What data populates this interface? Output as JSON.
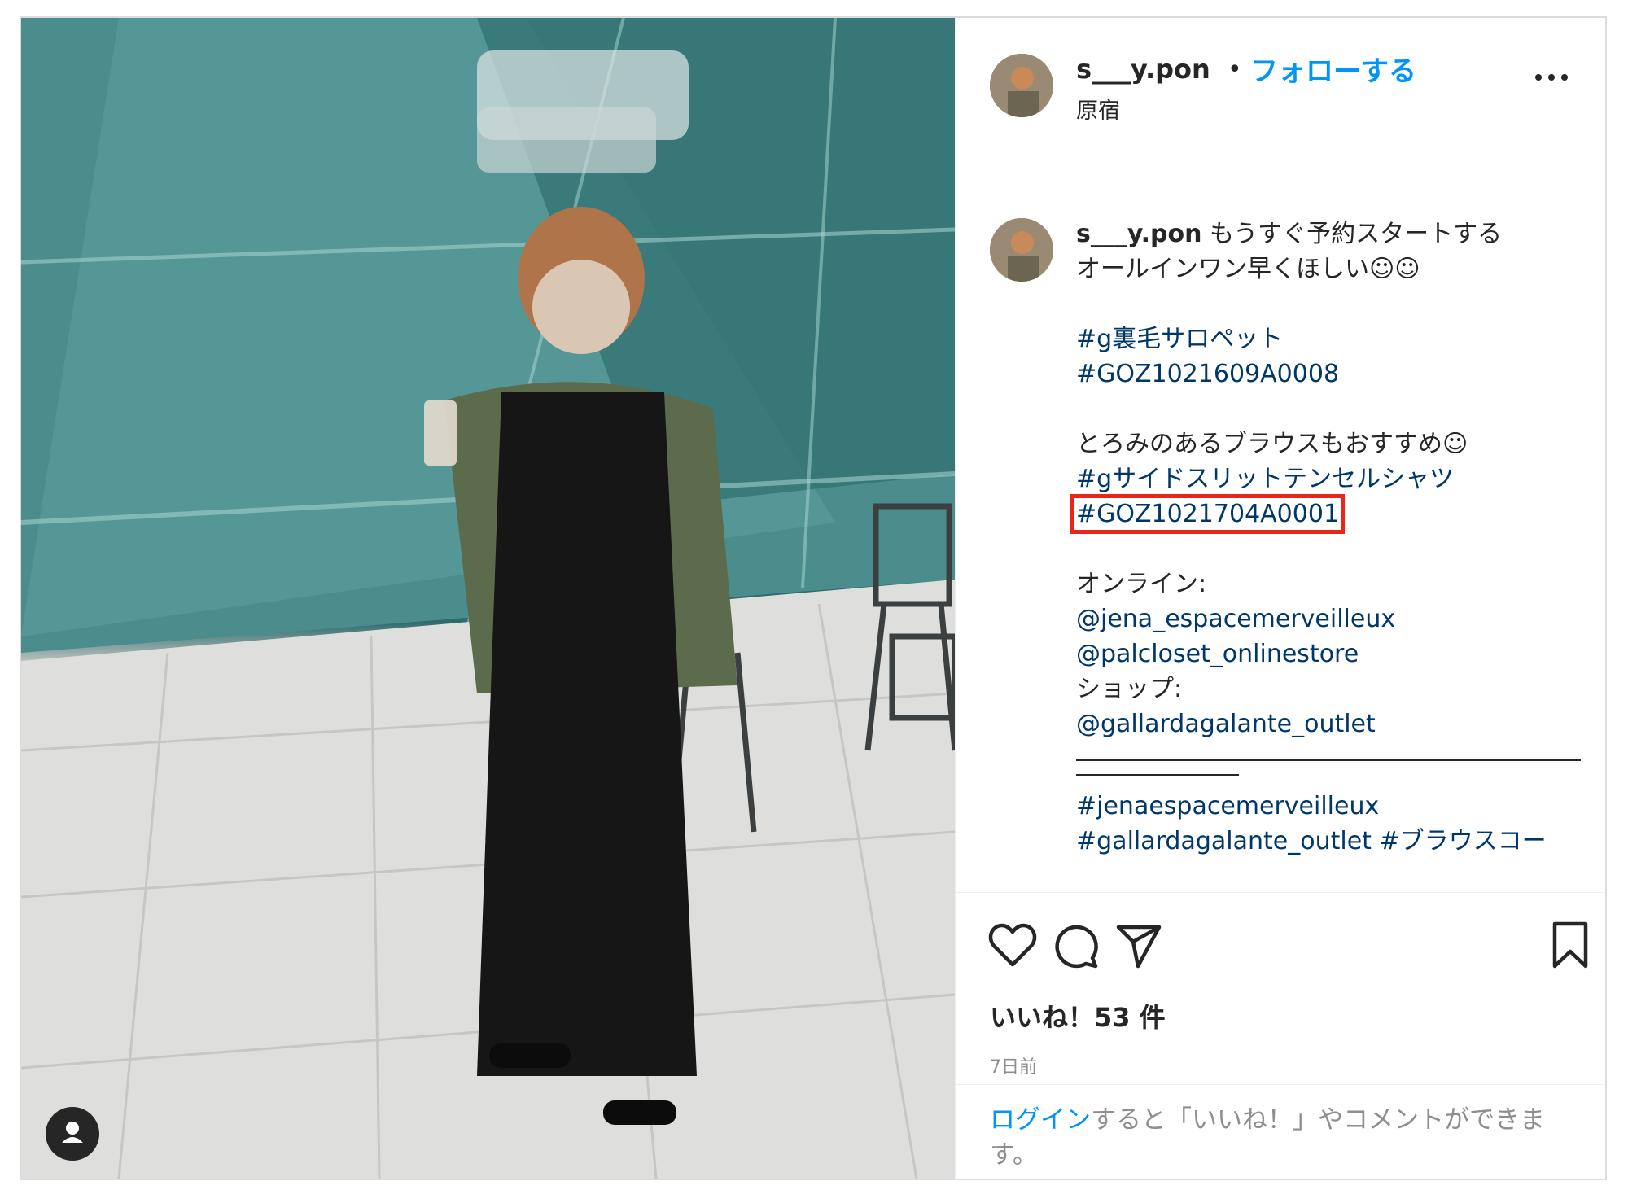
{
  "post": {
    "username": "s___y.pon",
    "follow_label": "フォローする",
    "separator": "•",
    "location": "原宿",
    "more_icon": "more-horizontal-icon"
  },
  "caption": {
    "username": "s___y.pon",
    "lines": [
      "もうすぐ予約スタートする",
      "オールインワン早くほしい☺☺",
      "",
      "#g裏毛サロペット",
      "#GOZ1021609A0008",
      "",
      "とろみのあるブラウスもおすすめ☺",
      "#gサイドスリットテンセルシャツ",
      "#GOZ1021704A0001",
      "",
      "オンライン:",
      "@jena_espacemerveilleux",
      "@palcloset_onlinestore",
      "ショップ:",
      "@gallardagalante_outlet",
      "",
      "#jenaespacemerveilleux",
      "#gallardagalante_outlet #ブラウスコー"
    ],
    "highlight_color": "#e8271a"
  },
  "actions": {
    "like_icon": "heart-icon",
    "comment_icon": "comment-icon",
    "share_icon": "send-icon",
    "save_icon": "bookmark-icon",
    "likes_text": "いいね！53 件",
    "time_text": "7日前"
  },
  "login": {
    "link_text": "ログイン",
    "rest_text": "すると「いいね！」やコメントができます。"
  },
  "colors": {
    "link_blue": "#0095f6",
    "hashtag_blue": "#00376b",
    "text": "#262626",
    "muted": "#8e8e8e"
  }
}
